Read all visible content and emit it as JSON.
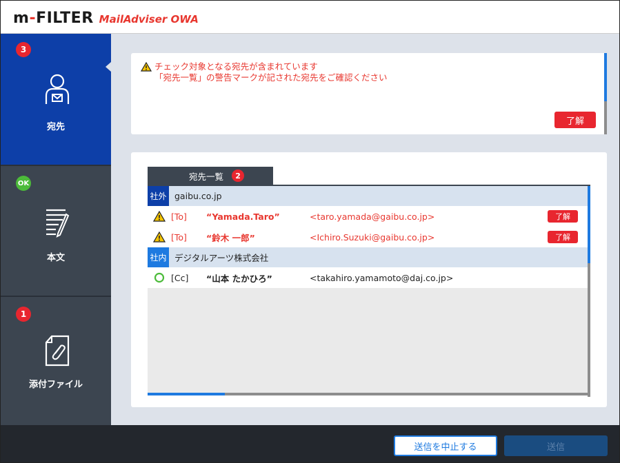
{
  "header": {
    "logo_main": "m-FILTER",
    "logo_sub": "MailAdviser OWA"
  },
  "sidebar": {
    "items": [
      {
        "badge": "3",
        "label": "宛先",
        "icon": "recipient-icon",
        "state": "active"
      },
      {
        "badge": "OK",
        "label": "本文",
        "icon": "document-edit-icon",
        "state": "ok"
      },
      {
        "badge": "1",
        "label": "添付ファイル",
        "icon": "attachment-file-icon",
        "state": "warning"
      }
    ]
  },
  "alert": {
    "line1": "チェック対象となる宛先が含まれています",
    "line2": "「宛先一覧」の警告マークが記された宛先をご確認ください",
    "ok_label": "了解"
  },
  "list": {
    "tab_label": "宛先一覧",
    "tab_badge": "2",
    "groups": [
      {
        "tag": "社外",
        "domain": "gaibu.co.jp",
        "rows": [
          {
            "type": "[To]",
            "name": "“Yamada.Taro”",
            "address": "<taro.yamada@gaibu.co.jp>",
            "button": "了解",
            "status": "warning"
          },
          {
            "type": "[To]",
            "name": "“鈴木 一郎”",
            "address": "<Ichiro.Suzuki@gaibu.co.jp>",
            "button": "了解",
            "status": "warning"
          }
        ]
      },
      {
        "tag": "社内",
        "domain": "デジタルアーツ株式会社",
        "rows": [
          {
            "type": "[Cc]",
            "name": "“山本 たかひろ”",
            "address": "<takahiro.yamamoto@daj.co.jp>",
            "status": "ok"
          }
        ]
      }
    ]
  },
  "footer": {
    "cancel_label": "送信を中止する",
    "send_label": "送信"
  },
  "colors": {
    "accent_red": "#e8262f",
    "active_blue": "#0d3fa8",
    "sidebar_bg": "#3c4550",
    "ok_green": "#4cbb3a"
  }
}
